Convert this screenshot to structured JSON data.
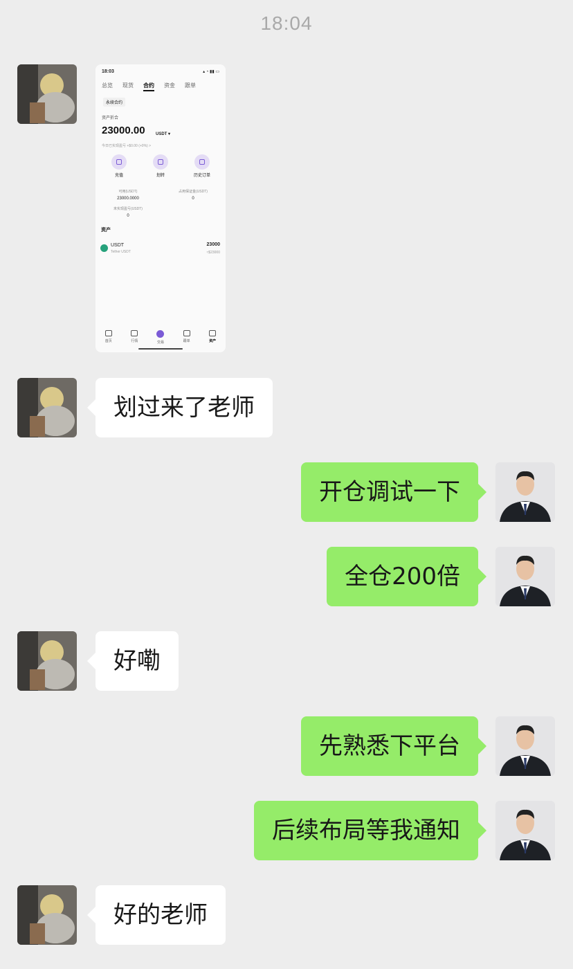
{
  "timestamp": "18:04",
  "screenshot": {
    "status_time": "18:03",
    "tabs": [
      "总览",
      "现货",
      "合约",
      "资金",
      "跟单"
    ],
    "active_tab_index": 2,
    "segment": "永续合约",
    "equity_label": "资产折合",
    "equity_value": "23000.00",
    "equity_unit": "USDT ▾",
    "pnl_text": "今日已实现盈亏 +$0.00 (+0%) >",
    "actions": [
      "充值",
      "划转",
      "历史订单"
    ],
    "stats": {
      "available_label": "可用(USDT)",
      "available_value": "23000.0000",
      "margin_label": "占用保证金(USDT)",
      "margin_value": "0",
      "unrealized_label": "未实现盈亏(USDT)",
      "unrealized_value": "0"
    },
    "section_title": "资产",
    "asset": {
      "name": "USDT",
      "subtitle": "Tether USDT",
      "amount": "23000",
      "usd_value": "≈$23000"
    },
    "nav": [
      "首页",
      "行情",
      "交易",
      "跟单",
      "资产"
    ]
  },
  "messages": [
    {
      "side": "left",
      "text": "划过来了老师"
    },
    {
      "side": "right",
      "text": "开仓调试一下"
    },
    {
      "side": "right",
      "text": "全仓200倍"
    },
    {
      "side": "left",
      "text": "好嘞"
    },
    {
      "side": "right",
      "text": "先熟悉下平台"
    },
    {
      "side": "right",
      "text": "后续布局等我通知"
    },
    {
      "side": "left",
      "text": "好的老师"
    }
  ],
  "colors": {
    "background": "#ededed",
    "sent_bubble": "#95ec69",
    "received_bubble": "#ffffff",
    "timestamp": "#a9a9a9"
  }
}
